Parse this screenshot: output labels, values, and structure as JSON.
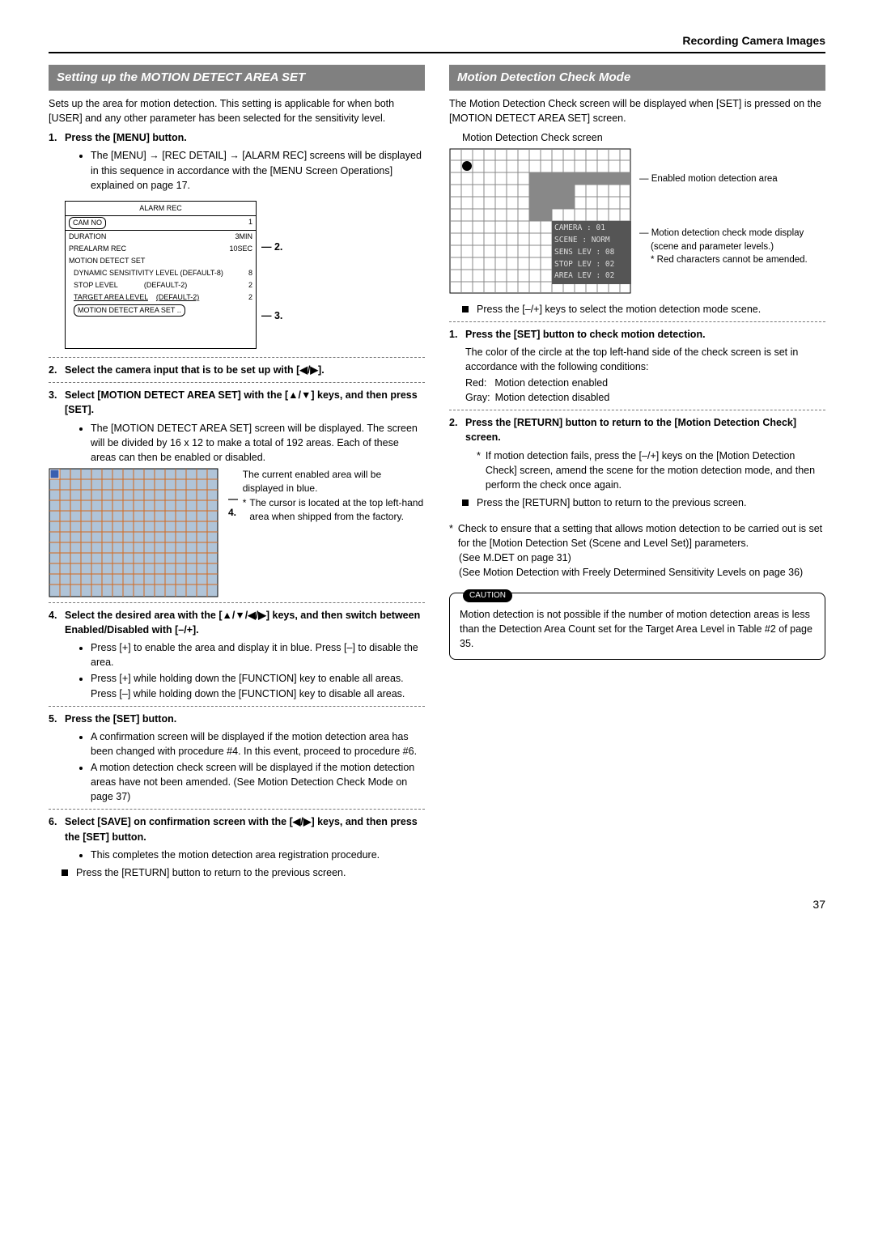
{
  "header": {
    "title": "Recording Camera Images"
  },
  "left": {
    "sectionTitle": "Setting up the MOTION DETECT AREA SET",
    "intro": "Sets up the area for motion detection. This setting is applicable for when both [USER] and any other parameter has been selected for the sensitivity level.",
    "step1": {
      "title": "Press the [MENU] button.",
      "b1": "The [MENU] → [REC DETAIL] → [ALARM REC] screens will be displayed in this sequence in accordance with the [MENU Screen Operations] explained on page 17."
    },
    "alarm": {
      "title": "ALARM REC",
      "camno_l": "CAM NO",
      "camno_v": "1",
      "dur_l": "DURATION",
      "dur_v": "3MIN",
      "pre_l": "PREALARM REC",
      "pre_v": "10SEC",
      "mds_l": "MOTION DETECT SET",
      "dyn_l": "DYNAMIC SENSITIVITY LEVEL (DEFAULT-8)",
      "dyn_v": "8",
      "stop_l": "STOP LEVEL",
      "stop_d": "(DEFAULT-2)",
      "stop_v": "2",
      "tgt_l": "TARGET AREA LEVEL",
      "tgt_d": "(DEFAULT-2)",
      "tgt_v": "2",
      "area_l": "MOTION DETECT AREA SET ..",
      "m2": "2.",
      "m3": "3."
    },
    "step2": "Select the camera input that is to be set up with [◀/▶].",
    "step3": {
      "title": "Select [MOTION DETECT AREA SET] with the [▲/▼] keys, and then press [SET].",
      "b1": "The [MOTION DETECT AREA SET] screen will be displayed. The screen will be divided by 16 x 12 to make a total of 192 areas. Each of these areas can then be enabled or disabled."
    },
    "gridNote": {
      "p": "The current enabled area will be displayed in blue.",
      "star": "The cursor is located at the top left-hand area when shipped from the factory.",
      "m4": "4."
    },
    "step4": {
      "title": "Select the desired area with the [▲/▼/◀/▶] keys, and then switch between Enabled/Disabled with [–/+].",
      "b1": "Press [+] to enable the area and display it in blue. Press [–] to disable the area.",
      "b2": "Press [+] while holding down the [FUNCTION] key to enable all areas. Press [–] while holding down the [FUNCTION] key to disable all areas."
    },
    "step5": {
      "title": "Press the [SET] button.",
      "b1": "A confirmation screen will be displayed if the motion detection area has been changed with procedure #4. In this event, proceed to procedure #6.",
      "b2": "A motion detection check screen will be displayed if the motion detection areas have not been amended. (See Motion Detection Check Mode on page 37)"
    },
    "step6": {
      "title": "Select [SAVE] on confirmation screen with the [◀/▶] keys, and then press the [SET] button.",
      "b1": "This completes the motion detection area registration procedure."
    },
    "final": "Press the [RETURN] button to return to the previous screen."
  },
  "right": {
    "sectionTitle": "Motion Detection Check Mode",
    "intro": "The Motion Detection Check screen will be displayed when [SET] is pressed on the [MOTION DETECT AREA SET] screen.",
    "caption": "Motion Detection Check screen",
    "annot": {
      "a1": "Enabled motion detection area",
      "a2": "Motion detection check mode display",
      "a3": "(scene and parameter levels.)",
      "a4": "* Red characters cannot be amended."
    },
    "osd": {
      "cam": "CAMERA : 01",
      "scene": "SCENE    : NORM",
      "sens": "SENS LEV : 08",
      "stop": "STOP LEV : 02",
      "area": "AREA LEV : 02"
    },
    "sq1": "Press the [–/+] keys to select the motion detection mode scene.",
    "step1": {
      "title": "Press the [SET] button to check motion detection.",
      "p1": "The color of the circle at the top left-hand side of the check screen is set in accordance with the following conditions:",
      "red_l": "Red:",
      "red_v": "Motion detection enabled",
      "gray_l": "Gray:",
      "gray_v": "Motion detection disabled"
    },
    "step2": {
      "title": "Press the [RETURN] button to return to the [Motion Detection Check] screen.",
      "star": "If motion detection fails, press the [–/+] keys on the [Motion Detection Check] screen, amend the scene for the motion detection mode, and then perform the check once again."
    },
    "sq2": "Press the [RETURN] button to return to the previous screen.",
    "note2": {
      "star": "Check to ensure that a setting that allows motion detection to be carried out is set for the [Motion Detection Set (Scene and Level Set)] parameters.",
      "see1": "(See M.DET on page 31)",
      "see2": "(See Motion Detection with Freely Determined Sensitivity Levels on page 36)"
    },
    "caution": {
      "tag": "CAUTION",
      "body": "Motion detection is not possible if the number of motion detection areas is less than the Detection Area Count set for the Target Area Level in Table #2 of page 35."
    }
  },
  "page": "37"
}
